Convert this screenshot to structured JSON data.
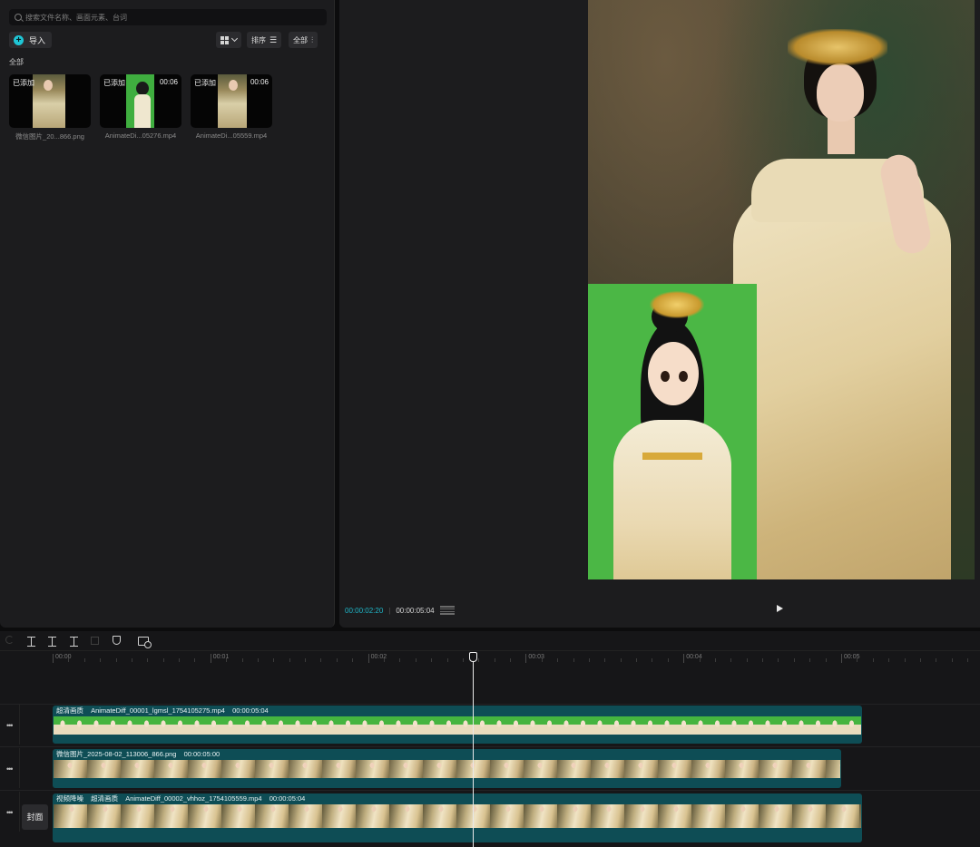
{
  "media": {
    "search_placeholder": "搜索文件名称、画面元素、台词",
    "import_label": "导入",
    "sort_label": "排序",
    "filter_label": "全部",
    "section_label": "全部",
    "assets": [
      {
        "badge": "已添加",
        "duration": "",
        "name": "微信图片_20...866.png",
        "kind": "photo"
      },
      {
        "badge": "已添加",
        "duration": "00:06",
        "name": "AnimateDi...05276.mp4",
        "kind": "green"
      },
      {
        "badge": "已添加",
        "duration": "00:06",
        "name": "AnimateDi...05559.mp4",
        "kind": "photo"
      }
    ]
  },
  "preview": {
    "current_time": "00:00:02:20",
    "total_time": "00:00:05:04"
  },
  "timeline": {
    "ruler_labels": [
      "00:00",
      "00:01",
      "00:02",
      "00:03",
      "00:04",
      "00:05"
    ],
    "cover_label": "封面",
    "tracks": [
      {
        "tags": [
          "超清画质"
        ],
        "name": "AnimateDiff_00001_lgmsl_1754105275.mp4",
        "duration": "00:00:05:04",
        "style": "green"
      },
      {
        "tags": [],
        "name": "微信图片_2025-08-02_113006_866.png",
        "duration": "00:00:05:00",
        "style": "photo"
      },
      {
        "tags": [
          "视频降噪",
          "超清画质"
        ],
        "name": "AnimateDiff_00002_vhhoz_1754105559.mp4",
        "duration": "00:00:05:04",
        "style": "photo2"
      }
    ]
  },
  "colors": {
    "accent": "#1fc6d6",
    "clip": "#0e4d55",
    "green_screen": "#4bb745"
  }
}
